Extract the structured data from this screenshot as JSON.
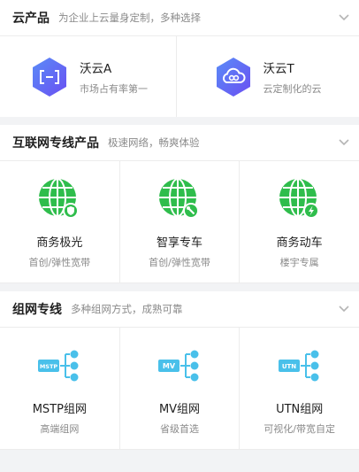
{
  "cloud": {
    "title": "云产品",
    "subtitle": "为企业上云量身定制，多种选择",
    "items": [
      {
        "name": "沃云A",
        "desc": "市场占有率第一"
      },
      {
        "name": "沃云T",
        "desc": "云定制化的云"
      }
    ]
  },
  "internet": {
    "title": "互联网专线产品",
    "subtitle": "极速网络，畅爽体验",
    "items": [
      {
        "name": "商务极光",
        "desc": "首创/弹性宽带"
      },
      {
        "name": "智享专车",
        "desc": "首创/弹性宽带"
      },
      {
        "name": "商务动车",
        "desc": "楼宇专属"
      }
    ]
  },
  "network": {
    "title": "组网专线",
    "subtitle": "多种组网方式，成熟可靠",
    "items": [
      {
        "name": "MSTP组网",
        "desc": "高端组网",
        "badge": "MSTP"
      },
      {
        "name": "MV组网",
        "desc": "省级首选",
        "badge": "MV"
      },
      {
        "name": "UTN组网",
        "desc": "可视化/带宽自定",
        "badge": "UTN"
      }
    ]
  },
  "colors": {
    "green": "#2fbd4c",
    "cyan": "#49c0ea",
    "hexBlue": "#5b6cf6"
  }
}
